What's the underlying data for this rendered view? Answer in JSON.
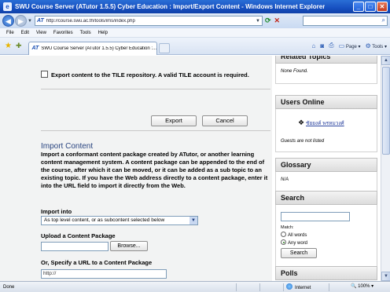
{
  "window": {
    "title": "SWU Course Server (ATutor 1.5.5) Cyber Education : Import/Export Content - Windows Internet Explorer",
    "buttons": {
      "minimize": "_",
      "maximize": "□",
      "close": "✕"
    }
  },
  "address_bar": {
    "favicon": "AT",
    "url": "http://course.swu.ac.th/tools/ims/index.php"
  },
  "menu": [
    "File",
    "Edit",
    "View",
    "Favorites",
    "Tools",
    "Help"
  ],
  "tab": {
    "favicon": "AT",
    "label": "SWU Course Server (ATutor 1.5.5) Cyber Education :..."
  },
  "commands": {
    "page": "Page",
    "tools": "Tools"
  },
  "export": {
    "checkbox_label": "Export content to the TILE repository. A valid TILE account is required.",
    "export_button": "Export",
    "cancel_button": "Cancel"
  },
  "import": {
    "title": "Import Content",
    "description": "Import a conformant content package created by ATutor, or another learning content management system. A content package can be appended to the end of the course, after which it can be moved, or it can be added as a sub topic to an existing topic. If you have the Web address directly to a content package, enter it into the URL field to import it directly from the Web.",
    "import_into_label": "Import into",
    "import_into_value": "As top level content, or as subcontent selected below",
    "upload_label": "Upload a Content Package",
    "browse_button": "Browse...",
    "url_label": "Or, Specify a URL to a Content Package",
    "url_value": "http://"
  },
  "sidebar": {
    "related_title": "Related Topics",
    "related_body": "None Found.",
    "users_title": "Users Online",
    "user_name": "ชัยยงค์ พรหมวงศ์",
    "guests_note": "Guests are not listed",
    "glossary_title": "Glossary",
    "glossary_body": "N/A",
    "search_title": "Search",
    "match_label": "Match:",
    "all_words": "All words",
    "any_word": "Any word",
    "search_button": "Search",
    "polls_title": "Polls"
  },
  "status": {
    "left": "Done",
    "zone": "Internet",
    "zoom": "100%"
  }
}
